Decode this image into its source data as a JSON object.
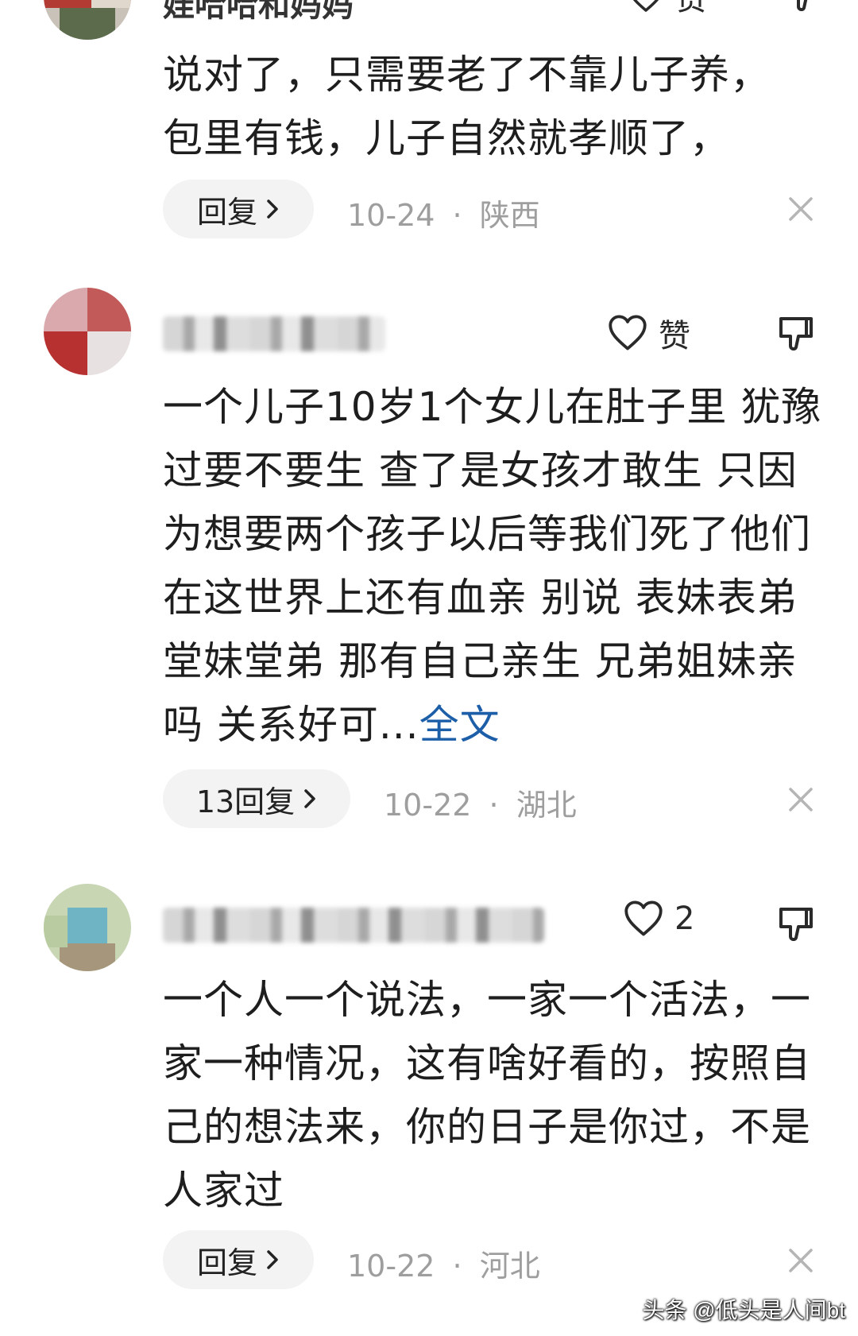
{
  "comments": [
    {
      "username": "娃哈哈和妈妈",
      "like_label": "赞",
      "body": "说对了，只需要老了不靠儿子养，包里有钱，儿子自然就孝顺了，",
      "reply_label": "回复",
      "date": "10-24",
      "region": "陕西"
    },
    {
      "like_label": "赞",
      "body": "一个儿子10岁1个女儿在肚子里 犹豫过要不要生 查了是女孩才敢生 只因为想要两个孩子以后等我们死了他们在这世界上还有血亲 别说 表妹表弟堂妹堂弟 那有自己亲生 兄弟姐妹亲吗 关系好可...",
      "more_label": "全文",
      "reply_label": "13回复",
      "date": "10-22",
      "region": "湖北"
    },
    {
      "like_label": "2",
      "body": "一个人一个说法，一家一个活法，一家一种情况，这有啥好看的，按照自己的想法来，你的日子是你过，不是人家过",
      "reply_label": "回复",
      "date": "10-22",
      "region": "河北"
    }
  ],
  "separator": "·",
  "watermark": "头条 @低头是人间bt",
  "colors": {
    "link": "#1c5fa8",
    "meta": "#9e9e9e",
    "pill": "#f3f3f3"
  },
  "icons": [
    "heart-icon",
    "thumb-down-icon",
    "chevron-right-icon",
    "close-icon",
    "avatar"
  ]
}
